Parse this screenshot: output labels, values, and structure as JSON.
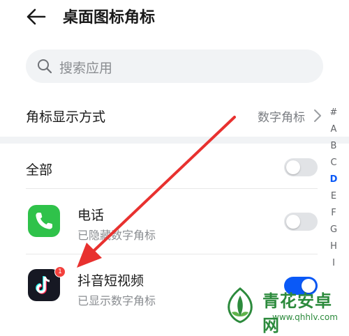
{
  "header": {
    "title": "桌面图标角标"
  },
  "search": {
    "placeholder": "搜索应用"
  },
  "badge_mode": {
    "label": "角标显示方式",
    "value": "数字角标"
  },
  "all_toggle": {
    "label": "全部",
    "on": false
  },
  "apps": [
    {
      "name": "电话",
      "status": "已隐藏数字角标",
      "icon": "phone-icon",
      "color": "#2fc24a",
      "toggle_on": false
    },
    {
      "name": "抖音短视频",
      "status": "已显示数字角标",
      "icon": "douyin-icon",
      "color": "#161823",
      "badge": "1",
      "toggle_on": true
    }
  ],
  "alpha_index": [
    "#",
    "A",
    "B",
    "C",
    "D",
    "E",
    "F",
    "G",
    "H",
    "I"
  ],
  "alpha_active": "D",
  "watermark": {
    "text": "青花安卓网",
    "url": "www.qhhlv.com"
  },
  "colors": {
    "accent": "#0a59f7",
    "annotation_arrow": "#e8312f",
    "badge_red": "#f3403c"
  }
}
